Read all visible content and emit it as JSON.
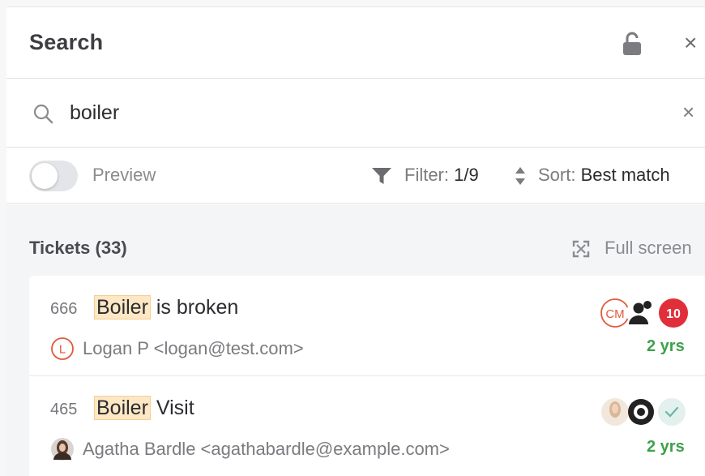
{
  "header": {
    "title": "Search",
    "lock_icon": "lock-open-icon",
    "close_icon": "close-icon"
  },
  "search": {
    "icon": "search-icon",
    "query": "boiler",
    "clear_icon": "clear-icon"
  },
  "toolbar": {
    "preview_label": "Preview",
    "preview_enabled": false,
    "filter_label": "Filter:",
    "filter_value": "1/9",
    "sort_label": "Sort:",
    "sort_value": "Best match"
  },
  "results": {
    "section_title": "Tickets (33)",
    "fullscreen_label": "Full screen",
    "tickets": [
      {
        "number": "666",
        "highlight": "Boiler",
        "title_rest": " is broken",
        "contact_initial": "L",
        "contact": "Logan P <logan@test.com>",
        "agent_initials": "CM",
        "unread_count": "10",
        "age": "2 yrs"
      },
      {
        "number": "465",
        "highlight": "Boiler",
        "title_rest": " Visit",
        "contact": "Agatha Bardle <agathabardle@example.com>",
        "agent_initials": "",
        "age": "2 yrs"
      }
    ]
  },
  "colors": {
    "highlight_bg": "#fde7c4",
    "age_green": "#3ea14a",
    "badge_red": "#e02f3a",
    "accent_orange": "#e3593c"
  }
}
